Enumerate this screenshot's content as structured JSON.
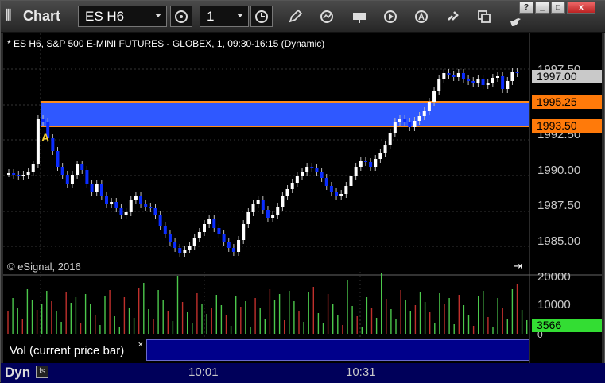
{
  "app": {
    "title": "Chart",
    "icon": "chart-app-icon"
  },
  "toolbar": {
    "symbol": "ES H6",
    "interval": "1",
    "buttons": [
      "clock-cycle-icon",
      "interval-clock-icon",
      "pencil-draw-icon",
      "refresh-icon",
      "get-icon",
      "play-icon",
      "a-circle-icon",
      "link-icon",
      "copy-icon",
      "bird-icon"
    ]
  },
  "window_controls": {
    "help": "?",
    "minimize": "_",
    "maximize": "□",
    "close": "x"
  },
  "chart": {
    "header": "* ES H6, S&P 500 E-MINI FUTURES - GLOBEX, 1, 09:30-16:15 (Dynamic)",
    "copyright": "© eSignal, 2016",
    "marker_label": "A",
    "price_labels": {
      "last": "1997.00",
      "upper": "1995.25",
      "lower": "1993.50"
    },
    "y_ticks": [
      "1997.50",
      "1992.50",
      "1990.00",
      "1987.50",
      "1985.00"
    ],
    "volume_ticks": [
      "20000",
      "10000",
      "0"
    ],
    "volume_last": "3566",
    "colors": {
      "zone": "#2f58ff",
      "zone_border": "#ff8c1a",
      "up": "#ffffff",
      "down": "#0a2cff",
      "vol_up": "#4cc94c",
      "vol_down": "#c0302c",
      "last_label": "#c9c9c9",
      "level_label": "#ff7a0a",
      "vol_label": "#33dd33"
    }
  },
  "legend": {
    "text": "Vol (current price bar)",
    "close": "×"
  },
  "bottom": {
    "mode": "Dyn",
    "times": [
      "10:01",
      "10:31"
    ]
  }
}
